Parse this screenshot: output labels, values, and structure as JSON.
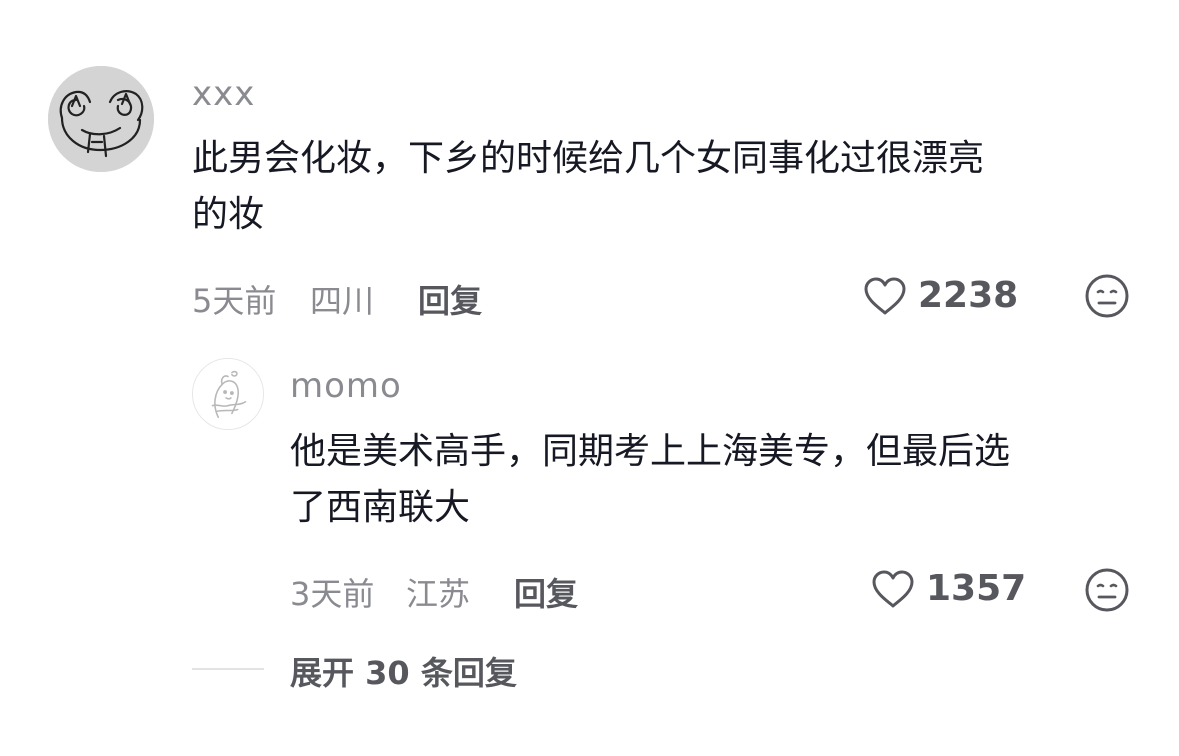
{
  "comment": {
    "username": "xxx",
    "avatar_icon": "frog-sketch-avatar",
    "text": "此男会化妆，下乡的时候给几个女同事化过很漂亮\n的妆",
    "time": "5天前",
    "location": "四川",
    "reply_label": "回复",
    "likes": "2238",
    "like_icon": "heart-outline-icon",
    "dislike_icon": "meh-face-icon"
  },
  "reply": {
    "username": "momo",
    "avatar_icon": "cartoon-character-avatar",
    "text": "他是美术高手，同期考上上海美专，但最后选\n了西南联大",
    "time": "3天前",
    "location": "江苏",
    "reply_label": "回复",
    "likes": "1357",
    "like_icon": "heart-outline-icon",
    "dislike_icon": "meh-face-icon"
  },
  "expand": {
    "label": "展开 30 条回复"
  },
  "colors": {
    "text_primary": "#161823",
    "text_secondary": "#8a8b91",
    "text_action": "#57585e"
  }
}
